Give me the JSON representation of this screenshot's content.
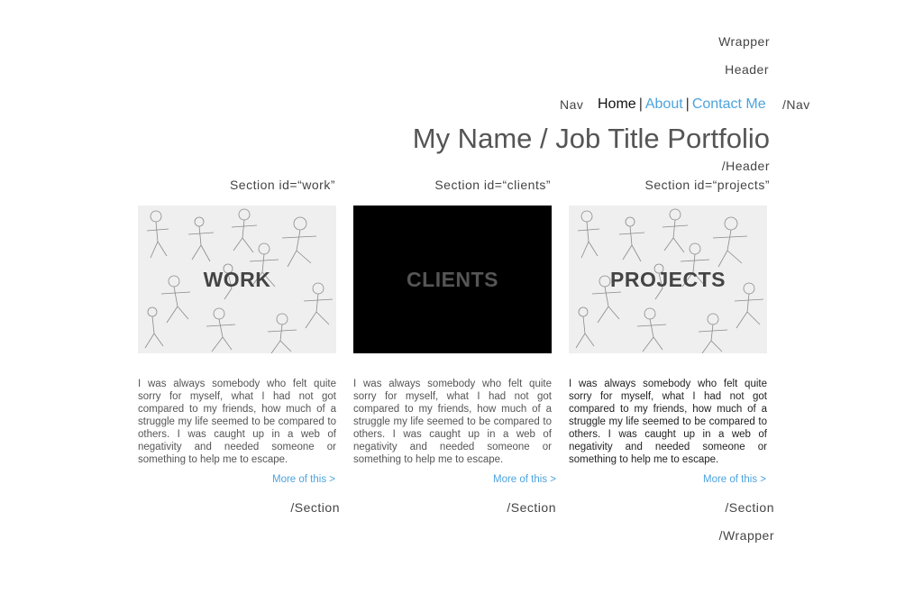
{
  "markers": {
    "wrapper_open": "Wrapper",
    "header_open": "Header",
    "nav_open": "Nav",
    "nav_close": "/Nav",
    "header_close": "/Header",
    "wrapper_close": "/Wrapper"
  },
  "nav": {
    "items": [
      {
        "label": "Home"
      },
      {
        "label": "About"
      },
      {
        "label": "Contact Me"
      }
    ],
    "separator": "|"
  },
  "header": {
    "title": "My Name / Job Title Portfolio"
  },
  "sections": [
    {
      "marker": "Section id=“work”",
      "tile_label": "WORK",
      "text": "I was always somebody who felt quite sorry for myself, what I had not got compared to my friends, how much of a struggle my life seemed to be compared to others. I was caught up in a web of negativity and needed someone or something to help me to escape.",
      "more": "More of this >",
      "close": "/Section"
    },
    {
      "marker": "Section id=“clients”",
      "tile_label": "CLIENTS",
      "text": "I was always somebody who felt quite sorry for myself, what I had not got compared to my friends, how much of a struggle my life seemed to be compared to others. I was caught up in a web of negativity and needed someone or something to help me to escape.",
      "more": "More of this >",
      "close": "/Section"
    },
    {
      "marker": "Section id=“projects”",
      "tile_label": "PROJECTS",
      "text": "I was always somebody who felt quite sorry for myself, what I had not got compared to my friends, how much of a struggle my life seemed to be compared to others. I was caught up in a web of negativity and needed someone or something to help me to escape.",
      "more": "More of this >",
      "close": "/Section"
    }
  ],
  "colors": {
    "link": "#4da3dd",
    "text": "#444444",
    "tile_dark": "#000000",
    "tile_light": "#efefef"
  }
}
